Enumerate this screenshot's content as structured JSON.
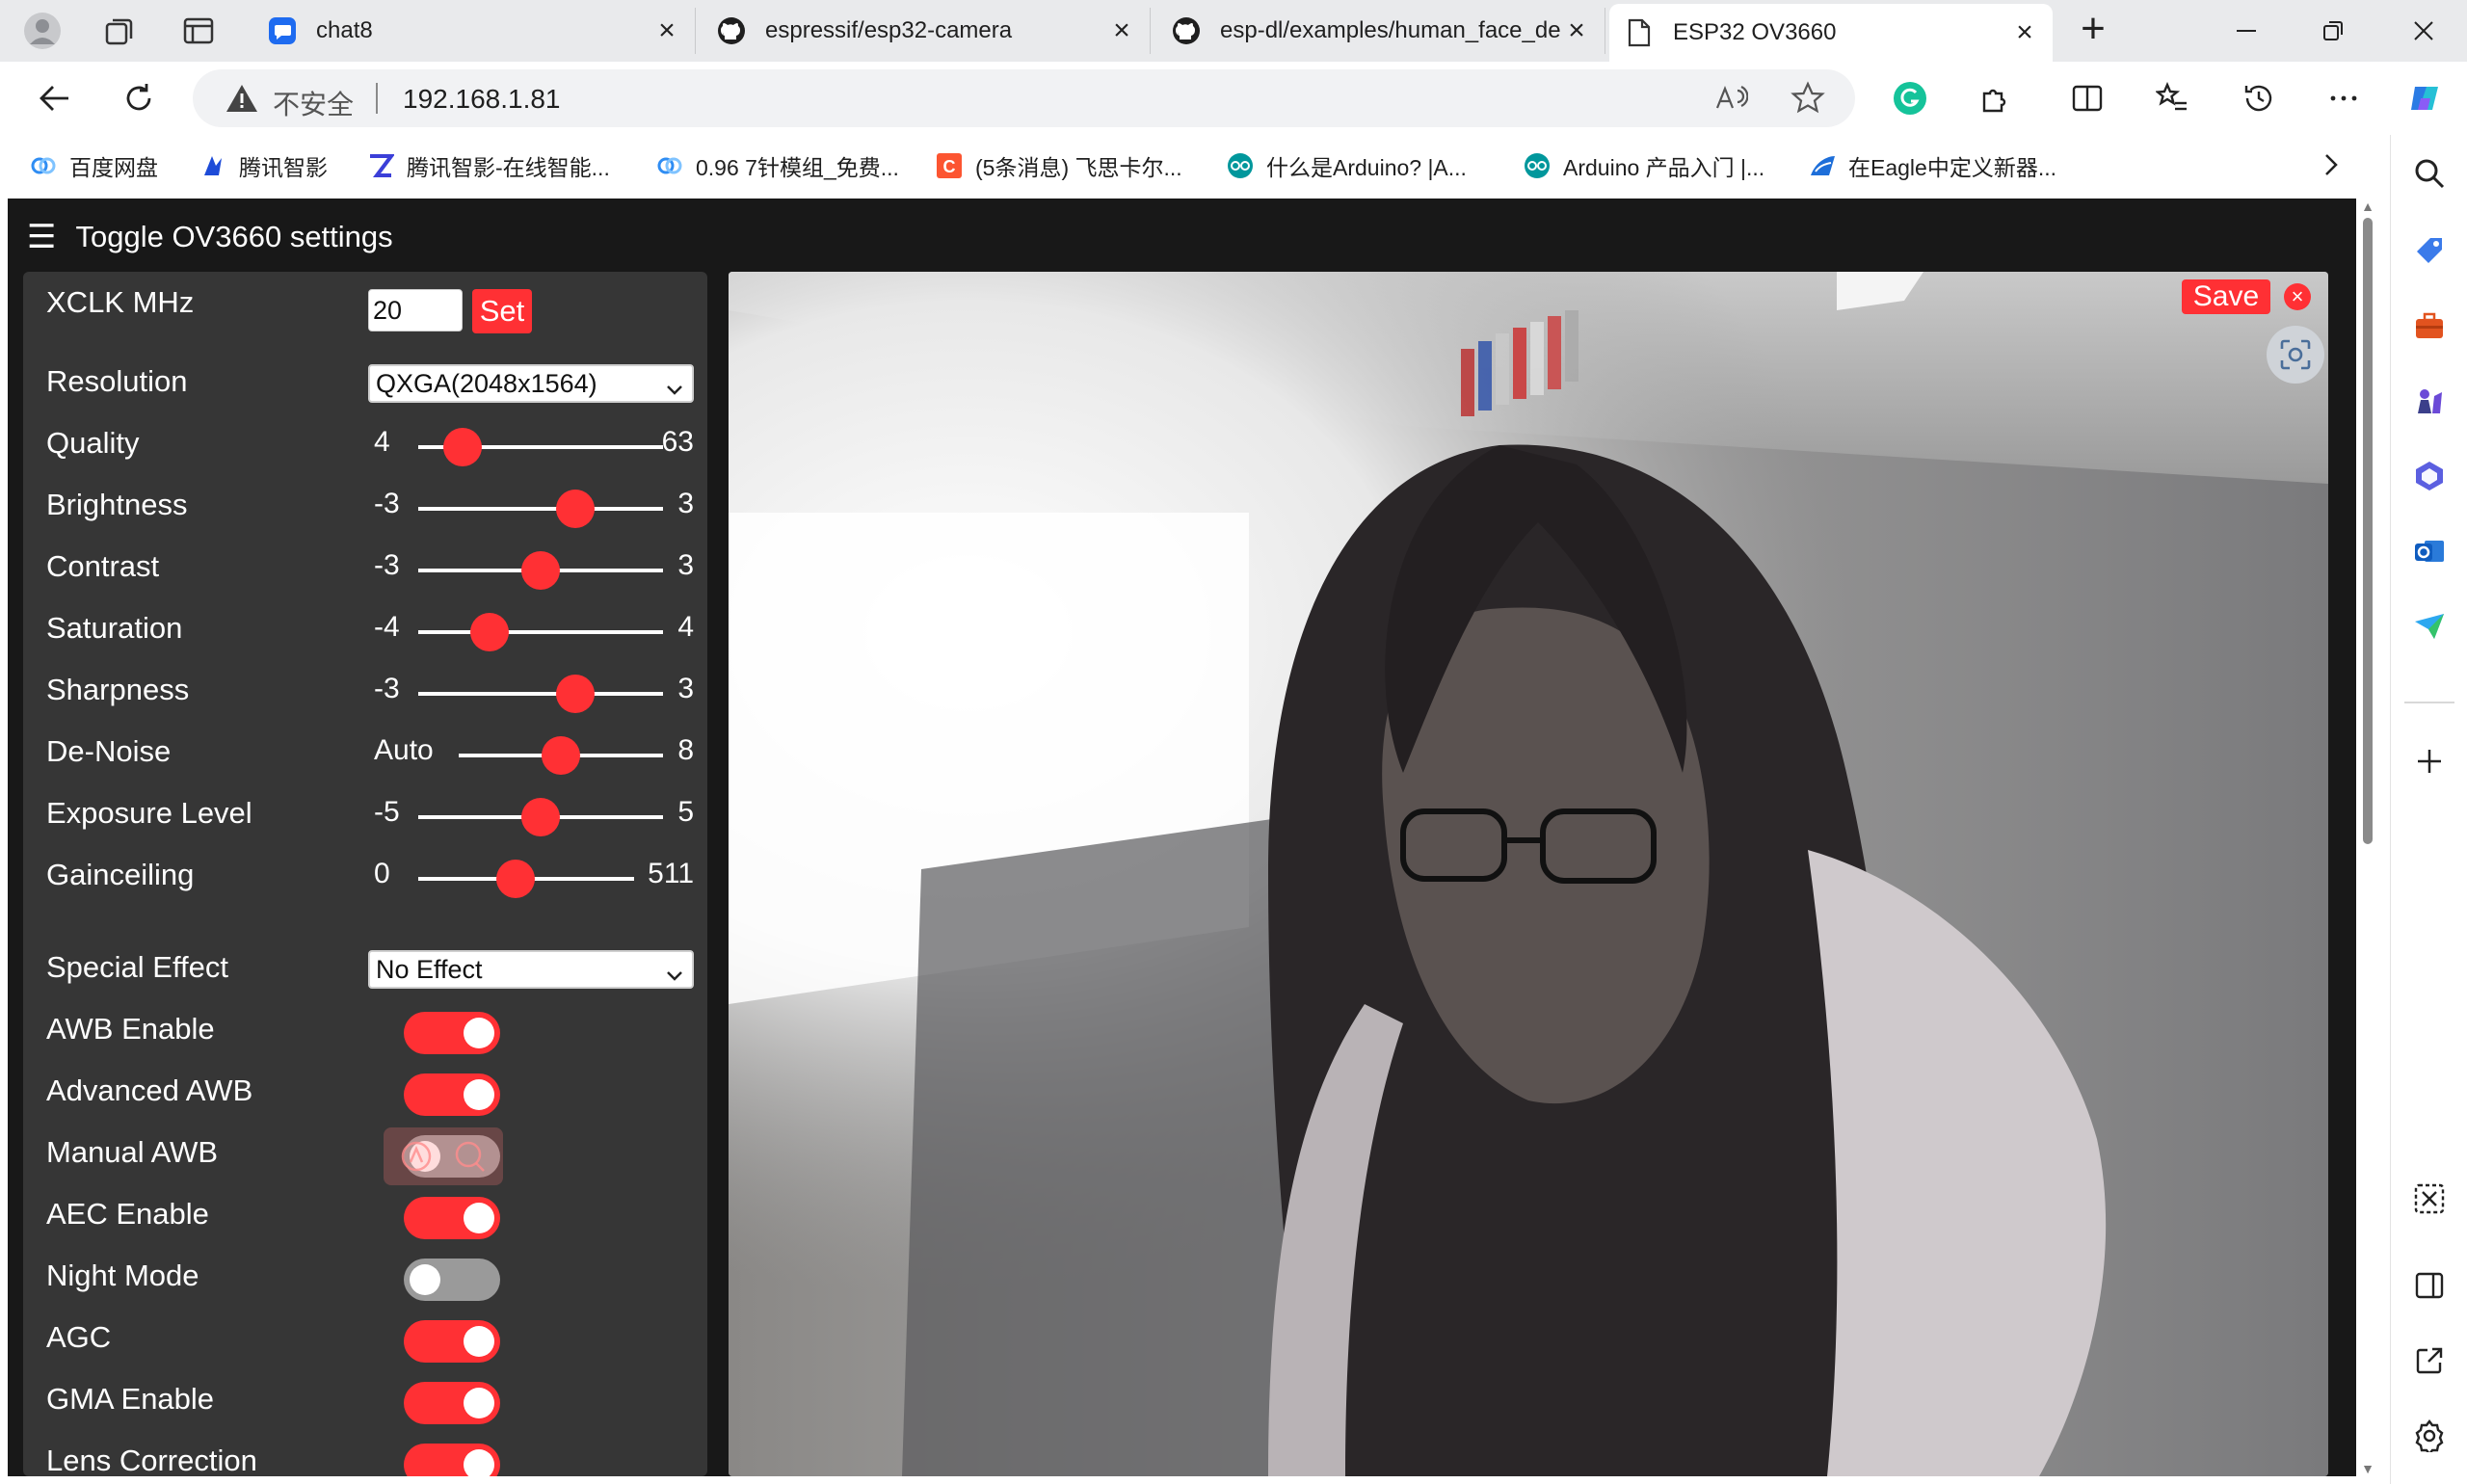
{
  "browser": {
    "tabs": [
      {
        "title": "chat8"
      },
      {
        "title": "espressif/esp32-camera"
      },
      {
        "title": "esp-dl/examples/human_face_de"
      },
      {
        "title": "ESP32 OV3660"
      }
    ],
    "address": {
      "security_text": "不安全",
      "url": "192.168.1.81"
    },
    "bookmarks": [
      {
        "label": "百度网盘"
      },
      {
        "label": "腾讯智影"
      },
      {
        "label": "腾讯智影-在线智能..."
      },
      {
        "label": "0.96 7针模组_免费..."
      },
      {
        "label": "(5条消息) 飞思卡尔..."
      },
      {
        "label": "什么是Arduino? |A..."
      },
      {
        "label": "Arduino 产品入门 |..."
      },
      {
        "label": "在Eagle中定义新器..."
      }
    ]
  },
  "page": {
    "toggle_label": "Toggle OV3660 settings",
    "xclk": {
      "label": "XCLK MHz",
      "value": "20",
      "button": "Set"
    },
    "resolution": {
      "label": "Resolution",
      "value": "QXGA(2048x1564)"
    },
    "sliders": [
      {
        "label": "Quality",
        "min": "4",
        "max": "63",
        "pos": 0.18
      },
      {
        "label": "Brightness",
        "min": "-3",
        "max": "3",
        "pos": 0.64
      },
      {
        "label": "Contrast",
        "min": "-3",
        "max": "3",
        "pos": 0.5
      },
      {
        "label": "Saturation",
        "min": "-4",
        "max": "4",
        "pos": 0.29
      },
      {
        "label": "Sharpness",
        "min": "-3",
        "max": "3",
        "pos": 0.64
      },
      {
        "label": "De-Noise",
        "min": "Auto",
        "max": "8",
        "pos": 0.5
      },
      {
        "label": "Exposure Level",
        "min": "-5",
        "max": "5",
        "pos": 0.5
      },
      {
        "label": "Gainceiling",
        "min": "0",
        "max": "511",
        "pos": 0.45
      }
    ],
    "special_effect": {
      "label": "Special Effect",
      "value": "No Effect"
    },
    "toggles": [
      {
        "label": "AWB Enable",
        "on": true
      },
      {
        "label": "Advanced AWB",
        "on": true
      },
      {
        "label": "Manual AWB",
        "on": false
      },
      {
        "label": "AEC Enable",
        "on": true
      },
      {
        "label": "Night Mode",
        "on": false
      },
      {
        "label": "AGC",
        "on": true
      },
      {
        "label": "GMA Enable",
        "on": true
      },
      {
        "label": "Lens Correction",
        "on": true
      }
    ],
    "stream": {
      "save_label": "Save",
      "close_label": "×"
    }
  },
  "colors": {
    "accent": "#ff3034",
    "panel": "#363636",
    "background": "#181818"
  }
}
